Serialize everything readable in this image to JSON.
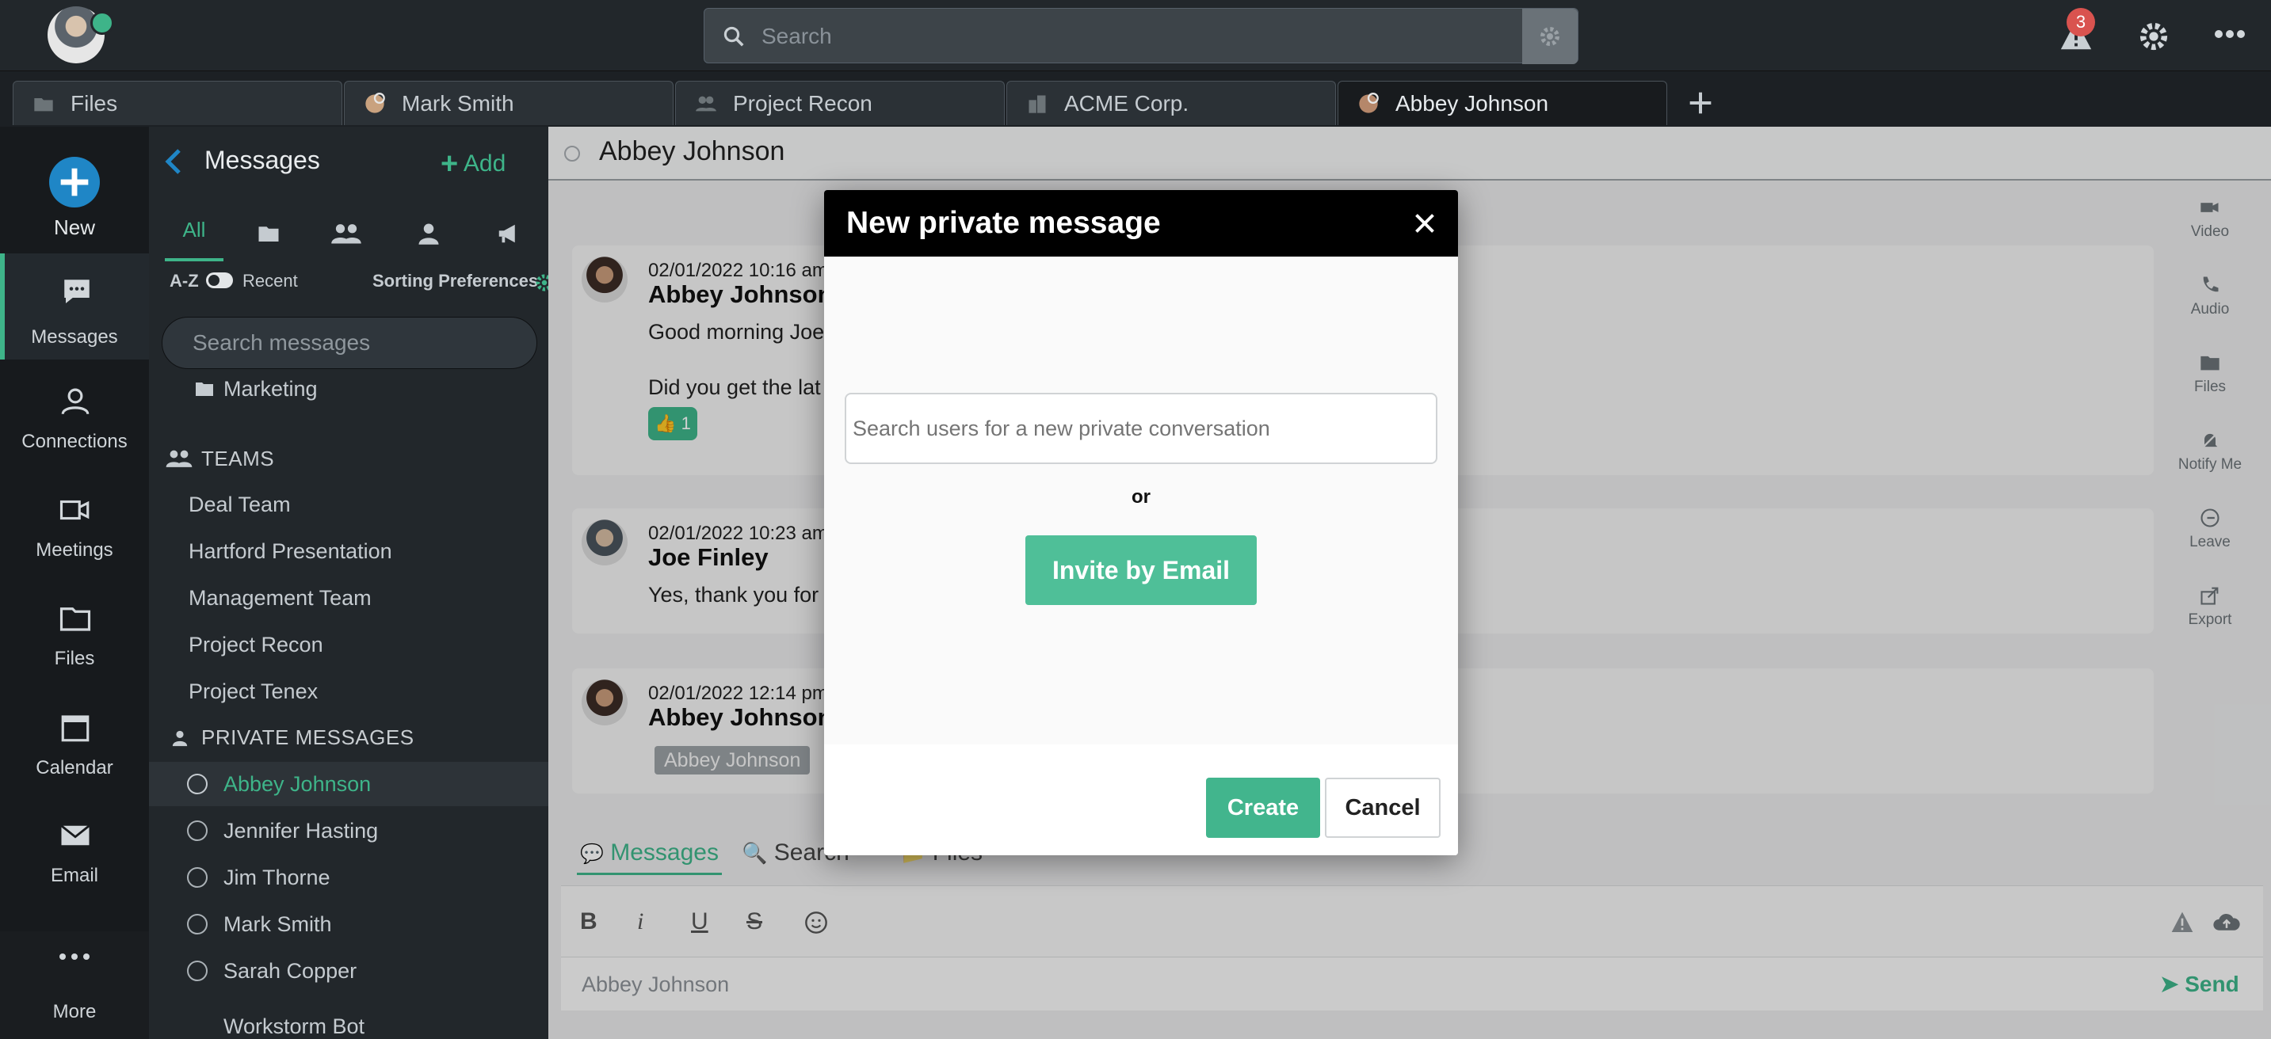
{
  "topbar": {
    "search_placeholder": "Search",
    "notification_count": "3"
  },
  "tabs": [
    {
      "label": "Files",
      "icon": "folder-icon"
    },
    {
      "label": "Mark Smith",
      "icon": "avatar-icon"
    },
    {
      "label": "Project Recon",
      "icon": "team-icon"
    },
    {
      "label": "ACME Corp.",
      "icon": "building-icon"
    },
    {
      "label": "Abbey Johnson",
      "icon": "avatar-icon",
      "active": true
    }
  ],
  "rail": {
    "new_label": "New",
    "items": [
      {
        "label": "Messages",
        "icon": "chat-icon",
        "active": true
      },
      {
        "label": "Connections",
        "icon": "person-icon"
      },
      {
        "label": "Meetings",
        "icon": "video-icon"
      },
      {
        "label": "Files",
        "icon": "folder-icon"
      },
      {
        "label": "Calendar",
        "icon": "calendar-icon"
      },
      {
        "label": "Email",
        "icon": "envelope-icon"
      }
    ],
    "more_label": "More"
  },
  "panel": {
    "title": "Messages",
    "add_label": "Add",
    "filter_all": "All",
    "sort_az": "A-Z",
    "sort_recent": "Recent",
    "sorting_preferences": "Sorting Preferences",
    "search_placeholder": "Search messages",
    "folders": [
      "Marketing"
    ],
    "teams_header": "TEAMS",
    "teams": [
      "Deal Team",
      "Hartford Presentation",
      "Management Team",
      "Project Recon",
      "Project Tenex"
    ],
    "private_header": "PRIVATE MESSAGES",
    "private": [
      {
        "name": "Abbey Johnson",
        "active": true
      },
      {
        "name": "Jennifer Hasting"
      },
      {
        "name": "Jim Thorne"
      },
      {
        "name": "Mark Smith"
      },
      {
        "name": "Sarah Copper"
      },
      {
        "name": "Workstorm Bot"
      }
    ]
  },
  "main": {
    "title": "Abbey Johnson",
    "messages": [
      {
        "timestamp": "02/01/2022 10:16 am",
        "author": "Abbey Johnson",
        "lines": [
          "Good morning Joe",
          "Did you get the lat"
        ],
        "reaction": "👍 1"
      },
      {
        "timestamp": "02/01/2022 10:23 am",
        "author": "Joe Finley",
        "lines": [
          "Yes, thank you for"
        ]
      },
      {
        "timestamp": "02/01/2022 12:14 pm",
        "author": "Abbey Johnson",
        "mention": "Abbey Johnson"
      }
    ],
    "right_actions": [
      "Video",
      "Audio",
      "Files",
      "Notify Me",
      "Leave",
      "Export"
    ],
    "bottom_tabs": [
      "Messages",
      "Search",
      "Files"
    ],
    "compose_placeholder": "Abbey Johnson",
    "send_label": "Send"
  },
  "modal": {
    "title": "New private message",
    "search_placeholder": "Search users for a new private conversation",
    "or_text": "or",
    "invite_label": "Invite by Email",
    "create_label": "Create",
    "cancel_label": "Cancel"
  },
  "colors": {
    "accent": "#3eb489",
    "dark": "#22272b",
    "badge": "#d9534f"
  }
}
